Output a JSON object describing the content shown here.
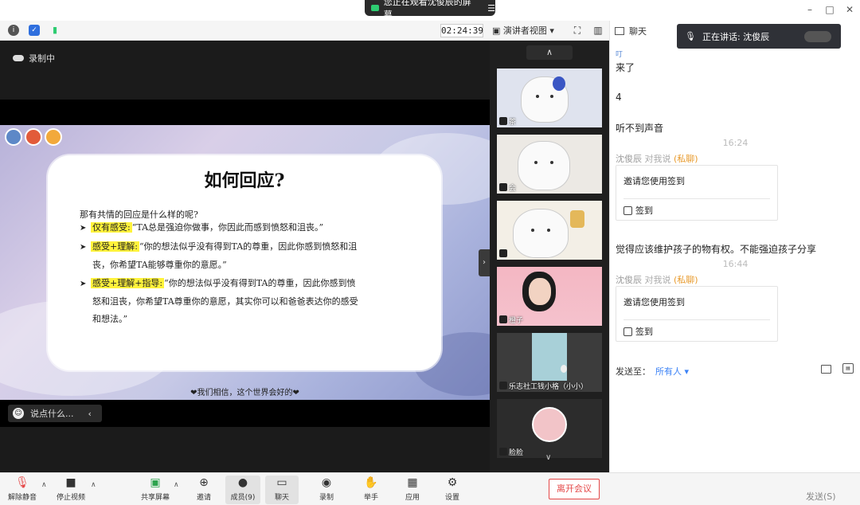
{
  "titlebar": {
    "share_notice": "您正在观看沈俊辰的屏幕",
    "minimize": "–",
    "maximize": "□",
    "close": "✕"
  },
  "topbar": {
    "timer": "02:24:39",
    "view_mode": "演讲者视图",
    "chat_tab": "聊天"
  },
  "stage": {
    "recording": "录制中",
    "chat_prompt": "说点什么..."
  },
  "slide": {
    "title": "如何回应?",
    "intro": "那有共情的回应是什么样的呢?",
    "bullets": [
      {
        "tag": "仅有感受:",
        "text": "“TA总是强迫你做事，你因此而感到愤怒和沮丧。”",
        "cont": ""
      },
      {
        "tag": "感受+理解:",
        "text": "“你的想法似乎没有得到TA的尊重，因此你感到愤怒和沮",
        "cont": "丧，你希望TA能够尊重你的意愿。”"
      },
      {
        "tag": "感受+理解+指导:",
        "text": "“你的想法似乎没有得到TA的尊重，因此你感到愤",
        "cont": "怒和沮丧，你希望TA尊重你的意愿，其实你可以和爸爸表达你的感受",
        "cont2": "和想法。”"
      }
    ],
    "footer": "❤我们相信，这个世界会好的❤"
  },
  "gallery": {
    "tiles": [
      {
        "name": "茶"
      },
      {
        "name": "会"
      },
      {
        "name": ""
      },
      {
        "name": "橙子"
      },
      {
        "name": "乐志社工钱小格（小小）"
      },
      {
        "name": "脸脸"
      }
    ]
  },
  "chat": {
    "speaking": "正在讲话: 沈俊辰",
    "messages": [
      {
        "sender": "叮",
        "text": "来了"
      },
      {
        "sender": "",
        "text": "4"
      },
      {
        "sender": "",
        "text": "听不到声音"
      }
    ],
    "time1": "16:24",
    "from1": "沈俊辰",
    "to_me": "对我说",
    "private": "(私聊)",
    "invite_text": "邀请您使用签到",
    "checkin": "签到",
    "msg4": "觉得应该维护孩子的物有权。不能强迫孩子分享",
    "time2": "16:44",
    "send_to_label": "发送至：",
    "send_to_value": "所有人 ▾",
    "send_button": "发送(S)"
  },
  "toolbar": {
    "unmute": "解除静音",
    "stop_video": "停止视频",
    "share_screen": "共享屏幕",
    "invite": "邀请",
    "members": "成员(9)",
    "chat": "聊天",
    "record": "录制",
    "raise_hand": "举手",
    "apps": "应用",
    "settings": "设置",
    "leave": "离开会议"
  },
  "colors": {
    "accent": "#3b82f6",
    "leave": "#e54848",
    "private": "#e89a2c"
  }
}
